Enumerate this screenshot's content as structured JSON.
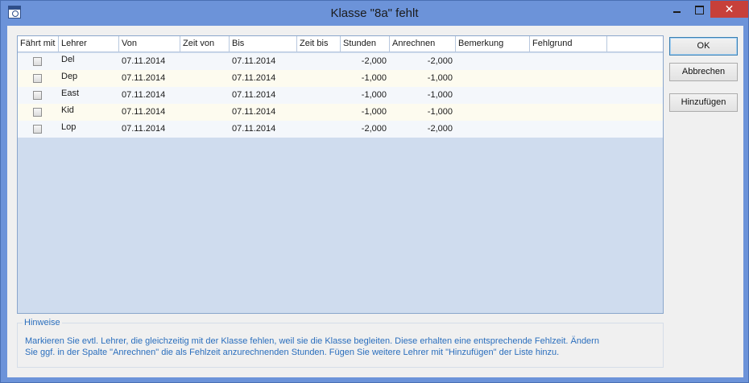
{
  "window": {
    "title": "Klasse \"8a\" fehlt",
    "close_glyph": "✕",
    "icon": "app-window-icon"
  },
  "table": {
    "columns": [
      "Fährt mit",
      "Lehrer",
      "Von",
      "Zeit von",
      "Bis",
      "Zeit bis",
      "Stunden",
      "Anrechnen",
      "Bemerkung",
      "Fehlgrund"
    ],
    "rows": [
      {
        "faehrt_mit": false,
        "lehrer": "Del",
        "von": "07.11.2014",
        "zeit_von": "",
        "bis": "07.11.2014",
        "zeit_bis": "",
        "stunden": "-2,000",
        "anrechnen": "-2,000",
        "bemerkung": "",
        "fehlgrund": ""
      },
      {
        "faehrt_mit": false,
        "lehrer": "Dep",
        "von": "07.11.2014",
        "zeit_von": "",
        "bis": "07.11.2014",
        "zeit_bis": "",
        "stunden": "-1,000",
        "anrechnen": "-1,000",
        "bemerkung": "",
        "fehlgrund": ""
      },
      {
        "faehrt_mit": false,
        "lehrer": "East",
        "von": "07.11.2014",
        "zeit_von": "",
        "bis": "07.11.2014",
        "zeit_bis": "",
        "stunden": "-1,000",
        "anrechnen": "-1,000",
        "bemerkung": "",
        "fehlgrund": ""
      },
      {
        "faehrt_mit": false,
        "lehrer": "Kid",
        "von": "07.11.2014",
        "zeit_von": "",
        "bis": "07.11.2014",
        "zeit_bis": "",
        "stunden": "-1,000",
        "anrechnen": "-1,000",
        "bemerkung": "",
        "fehlgrund": ""
      },
      {
        "faehrt_mit": false,
        "lehrer": "Lop",
        "von": "07.11.2014",
        "zeit_von": "",
        "bis": "07.11.2014",
        "zeit_bis": "",
        "stunden": "-2,000",
        "anrechnen": "-2,000",
        "bemerkung": "",
        "fehlgrund": ""
      }
    ]
  },
  "buttons": {
    "ok": "OK",
    "cancel": "Abbrechen",
    "add": "Hinzufügen"
  },
  "hints": {
    "title": "Hinweise",
    "line1": "Markieren Sie evtl. Lehrer, die gleichzeitig mit der Klasse fehlen, weil sie die Klasse begleiten. Diese erhalten eine entsprechende Fehlzeit. Ändern",
    "line2": "Sie ggf. in der Spalte \"Anrechnen\" die als Fehlzeit anzurechnenden Stunden. Fügen Sie weitere Lehrer mit \"Hinzufügen\" der Liste hinzu."
  },
  "colors": {
    "title_bar": "#6c93d9",
    "close_button": "#c7403a",
    "grid_background": "#cfdcee",
    "hint_text": "#2a6ebd"
  }
}
